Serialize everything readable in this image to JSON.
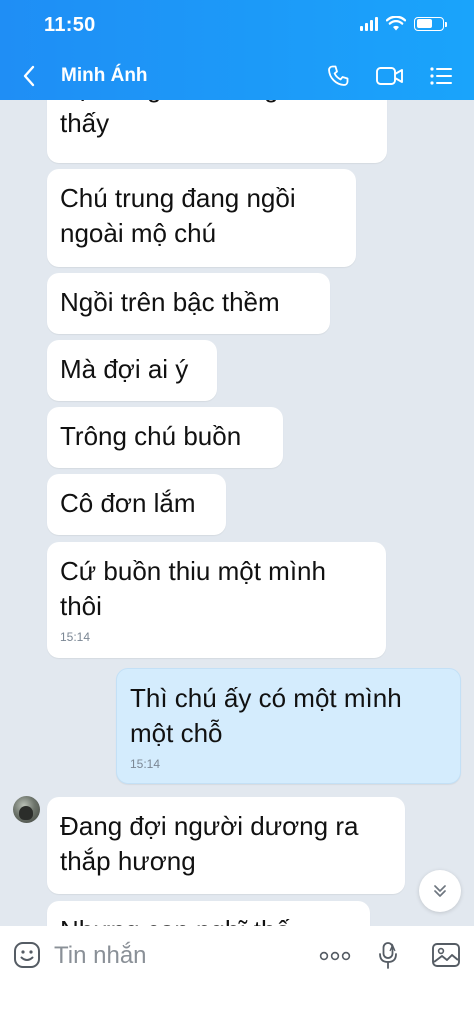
{
  "status_bar": {
    "time": "11:50",
    "battery_level": 0.6
  },
  "header": {
    "contact_name": "Minh Ánh"
  },
  "messages": [
    {
      "text": "Tự dưng con đứng nhìn\nthấy",
      "from": "them"
    },
    {
      "text": "Chú trung đang ngồi\nngoài mộ chú",
      "from": "them"
    },
    {
      "text": "Ngồi trên bậc thềm",
      "from": "them"
    },
    {
      "text": "Mà đợi ai ý",
      "from": "them"
    },
    {
      "text": "Trông chú buồn",
      "from": "them"
    },
    {
      "text": "Cô đơn lắm",
      "from": "them"
    },
    {
      "text": "Cứ buồn thiu một mình\nthôi",
      "from": "them",
      "time": "15:14"
    },
    {
      "text": "Thì chú ấy có một mình\nmột chỗ",
      "from": "me",
      "time": "15:14"
    },
    {
      "text": "Đang đợi người dương ra\nthắp hương",
      "from": "them"
    },
    {
      "text": "Nhưng con nghĩ thế ...",
      "from": "them"
    }
  ],
  "composer": {
    "placeholder": "Tin nhắn"
  },
  "icons": {
    "back": "chevron-left-icon",
    "call": "phone-icon",
    "video": "video-camera-icon",
    "menu": "list-menu-icon",
    "sticker": "sticker-smile-icon",
    "more": "more-dots-icon",
    "voice": "microphone-icon",
    "image": "image-gallery-icon",
    "scroll": "double-chevron-down-icon"
  },
  "colors": {
    "header": "#1f8ef5",
    "chat_bg": "#e2e8ef",
    "my_bubble": "#d4ecfd",
    "their_bubble": "#ffffff"
  }
}
